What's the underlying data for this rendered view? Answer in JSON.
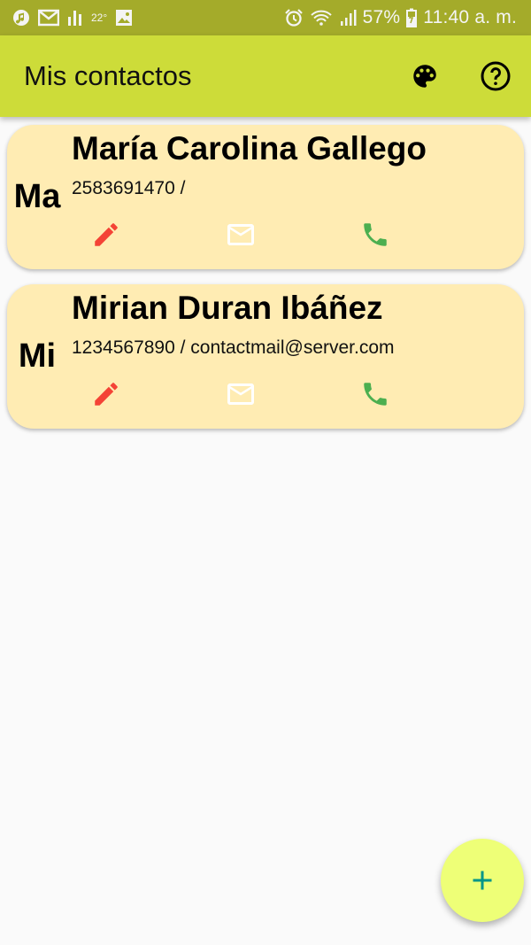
{
  "status_bar": {
    "left_icons": [
      "music-note-icon",
      "gmail-icon",
      "bar-chart-icon",
      "weather-icon",
      "image-icon"
    ],
    "temperature": "22°",
    "right_icons": [
      "alarm-icon",
      "wifi-icon",
      "signal-icon",
      "battery-charging-icon"
    ],
    "battery": "57%",
    "time": "11:40 a. m."
  },
  "app_bar": {
    "title": "Mis contactos",
    "actions": [
      "palette-icon",
      "help-icon"
    ],
    "color": "#cddc39"
  },
  "contacts": [
    {
      "initials": "Ma",
      "name": "María Carolina Gallego",
      "phone_email": "2583691470 /",
      "actions": [
        "edit-icon",
        "mail-icon",
        "phone-icon"
      ]
    },
    {
      "initials": "Mi",
      "name": "Mirian Duran Ibáñez",
      "phone_email": "1234567890 / contactmail@server.com",
      "actions": [
        "edit-icon",
        "mail-icon",
        "phone-icon"
      ]
    }
  ],
  "fab": {
    "icon": "add-icon"
  },
  "colors": {
    "card": "#ffecb3",
    "edit": "#f44336",
    "mail": "#ffffff",
    "call": "#4caf50",
    "fab": "#eeff77",
    "fab_icon": "#009688"
  }
}
